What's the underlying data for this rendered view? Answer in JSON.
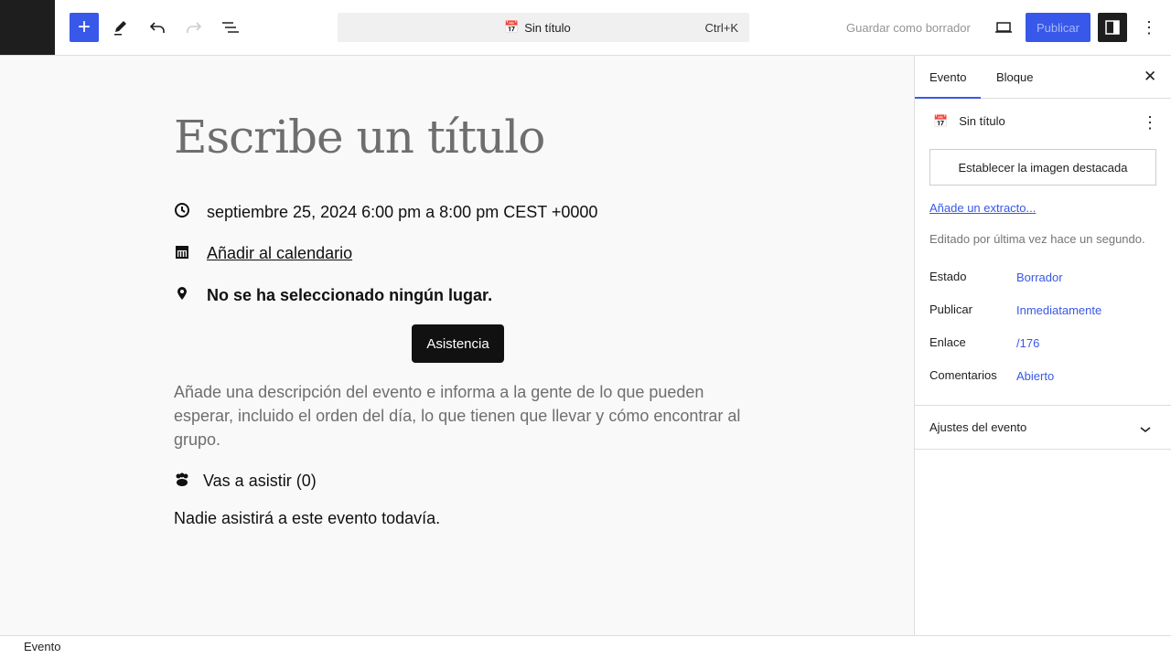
{
  "toolbar": {
    "command": "Sin título",
    "shortcut": "Ctrl+K",
    "save_draft": "Guardar como borrador",
    "publish": "Publicar"
  },
  "editor": {
    "title_placeholder": "Escribe un título",
    "datetime": "septiembre 25, 2024 6:00 pm a 8:00 pm CEST +0000",
    "calendar": "Añadir al calendario",
    "location": "No se ha seleccionado ningún lugar.",
    "rsvp_button": "Asistencia",
    "description": "Añade una descripción del evento e informa a la gente de lo que pueden esperar, incluido el orden del día, lo que tienen que llevar y cómo encontrar al grupo.",
    "attending": "Vas a asistir (0)",
    "no_attendees": "Nadie asistirá a este evento todavía."
  },
  "sidebar": {
    "tabs": [
      "Evento",
      "Bloque"
    ],
    "post_title": "Sin título",
    "featured_image": "Establecer la imagen destacada",
    "excerpt": "Añade un extracto...",
    "last_edited": "Editado por última vez hace un segundo.",
    "meta": [
      {
        "label": "Estado",
        "value": "Borrador"
      },
      {
        "label": "Publicar",
        "value": "Inmediatamente"
      },
      {
        "label": "Enlace",
        "value": "/176"
      },
      {
        "label": "Comentarios",
        "value": "Abierto"
      }
    ],
    "event_settings": "Ajustes del evento"
  },
  "footer": {
    "breadcrumb": "Evento"
  }
}
